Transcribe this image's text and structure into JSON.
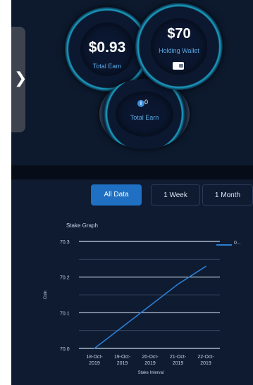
{
  "colors": {
    "accent": "#1f6fc2",
    "background": "#0c1628",
    "gauge_label": "#5aa9e6",
    "series_line": "#2a7fd4"
  },
  "side_handle": {
    "icon": "chevron-right-icon",
    "glyph": "❯"
  },
  "gauges": {
    "earn": {
      "value": "$0.93",
      "label": "Total Earn"
    },
    "wallet": {
      "value": "$70",
      "label": "Holding Wallet",
      "icon": "wallet-icon"
    },
    "total": {
      "value": "0",
      "label": "Total Earn",
      "icon": "info-icon",
      "icon_glyph": "i"
    }
  },
  "tabs": {
    "all": "All Data",
    "week": "1 Week",
    "month": "1 Month",
    "selected": "all"
  },
  "chart_data": {
    "type": "line",
    "title": "Stake Graph",
    "xlabel": "Stake Interval",
    "ylabel": "Coin",
    "categories": [
      "18-Oct-2019",
      "19-Oct-2019",
      "20-Oct-2019",
      "21-Oct-2019",
      "22-Oct-2019"
    ],
    "tick_labels": [
      [
        "18-Oct-",
        "2019"
      ],
      [
        "19-Oct-",
        "2019"
      ],
      [
        "20-Oct-",
        "2019"
      ],
      [
        "21-Oct-",
        "2019"
      ],
      [
        "22-Oct-",
        "2019"
      ]
    ],
    "y_ticks": [
      "70.0",
      "70.1",
      "70.2",
      "70.3"
    ],
    "ylim": [
      70.0,
      70.3
    ],
    "grid": true,
    "legend_position": "top-right",
    "series": [
      {
        "values": [
          70.0,
          70.06,
          70.12,
          70.18,
          70.23
        ]
      }
    ],
    "legend_label": "0..."
  }
}
